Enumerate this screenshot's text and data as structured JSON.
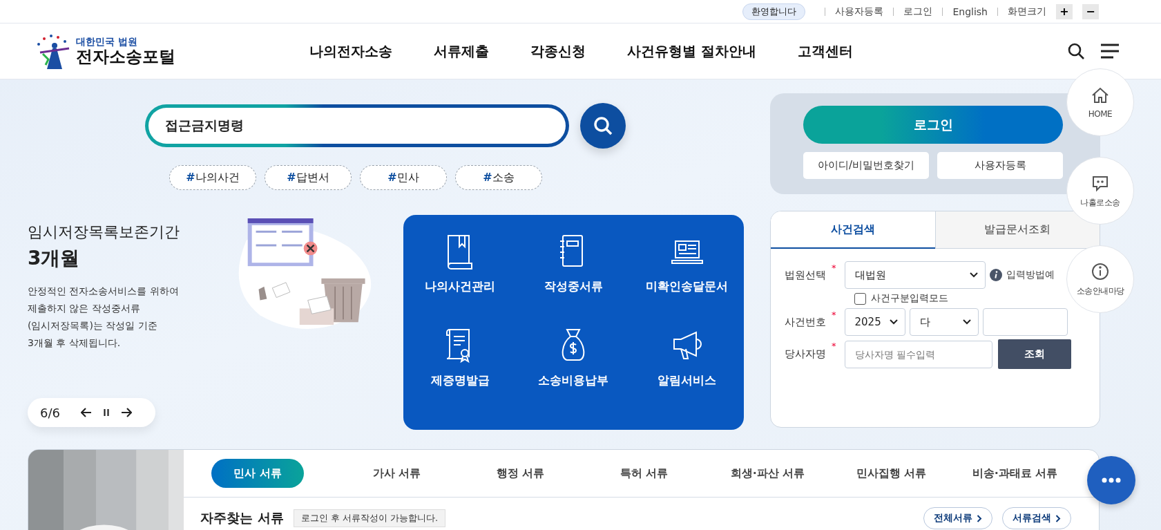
{
  "top_bar": {
    "welcome": "환영합니다",
    "links": [
      "사용자등록",
      "로그인",
      "English"
    ],
    "font_size": {
      "label": "화면크기",
      "buttons": [
        "+",
        "−"
      ]
    }
  },
  "logo": {
    "line1": "대한민국 법원",
    "line2": "전자소송포털"
  },
  "nav": [
    "나의전자소송",
    "서류제출",
    "각종신청",
    "사건유형별 절차안내",
    "고객센터"
  ],
  "search": {
    "value": "접근금지명령"
  },
  "tags": [
    {
      "mark": "#",
      "label": "나의사건"
    },
    {
      "mark": "#",
      "label": "답변서"
    },
    {
      "mark": "#",
      "label": "민사"
    },
    {
      "mark": "#",
      "label": "소송"
    }
  ],
  "promo": {
    "title": "임시저장목록보존기간",
    "highlight": "3개월",
    "body": [
      "안정적인 전자소송서비스를 위하여",
      "제출하지 않은 작성중서류",
      "(임시저장목록)는 작성일 기준",
      "3개월 후 삭제됩니다."
    ],
    "counter": "6/6"
  },
  "quick_menu": [
    "나의사건관리",
    "작성중서류",
    "미확인송달문서",
    "제증명발급",
    "소송비용납부",
    "알림서비스"
  ],
  "login": {
    "button": "로그인",
    "links": [
      "아이디/비밀번호찾기",
      "사용자등록"
    ]
  },
  "case_search": {
    "tabs": [
      {
        "label": "사건검색",
        "selected": true
      },
      {
        "label": "발급문서조회",
        "selected": false
      }
    ],
    "court": {
      "label": "법원선택",
      "mark": "*",
      "value": "대법원",
      "help": "입력방법예"
    },
    "mode": {
      "label": "사건구분입력모드",
      "checked": false
    },
    "case_number": {
      "label": "사건번호",
      "mark": "*",
      "year": "2025",
      "type": "다"
    },
    "party": {
      "label": "당사자명",
      "mark": "*",
      "placeholder": "당사자명 필수입력"
    },
    "submit": "조회"
  },
  "quick_links": [
    "HOME",
    "나홀로소송",
    "소송안내마당"
  ],
  "documents": {
    "tabs": [
      {
        "label": "민사 서류",
        "selected": true
      },
      {
        "label": "가사 서류",
        "selected": false
      },
      {
        "label": "행정 서류",
        "selected": false
      },
      {
        "label": "특허 서류",
        "selected": false
      },
      {
        "label": "회생·파산 서류",
        "selected": false
      },
      {
        "label": "민사집행 서류",
        "selected": false
      },
      {
        "label": "비송·과태료 서류",
        "selected": false
      }
    ],
    "title": "자주찾는 서류",
    "notice": "로그인 후 서류작성이 가능합니다.",
    "buttons": [
      "전체서류",
      "서류검색"
    ]
  }
}
